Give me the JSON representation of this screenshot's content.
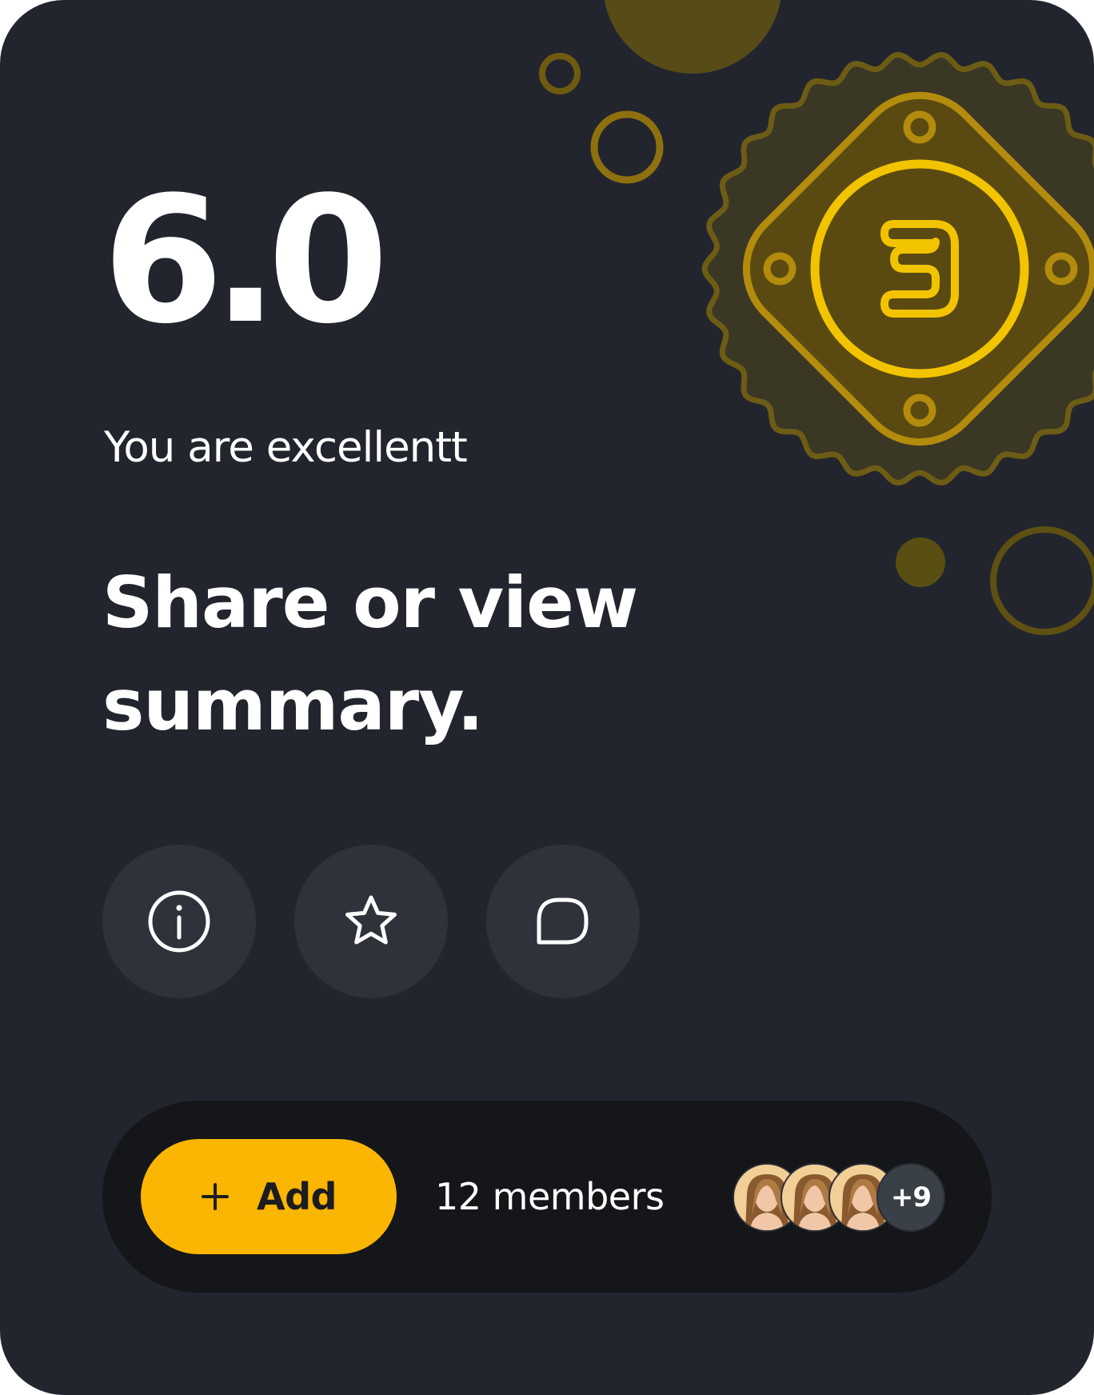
{
  "score": {
    "value": "6.0",
    "message": "You are excellentt"
  },
  "headline": {
    "line1": "Share or view",
    "line2": "summary."
  },
  "actions": [
    {
      "icon": "info-icon"
    },
    {
      "icon": "star-icon"
    },
    {
      "icon": "chat-bubble-icon"
    }
  ],
  "members_bar": {
    "add_label": "Add",
    "add_icon": "plus-icon",
    "members_text": "12 members",
    "more_count": "+9"
  },
  "badge": {
    "icon": "badge-number-3-icon"
  },
  "colors": {
    "card_background": "#23252e",
    "accent": "#fbb503",
    "badge_yellow": "#f2c400",
    "button_background": "#2f313b",
    "bar_background": "#151619"
  }
}
